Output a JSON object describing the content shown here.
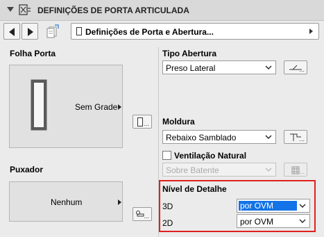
{
  "header": {
    "title": "DEFINIÇÕES DE PORTA ARTICULADA"
  },
  "toolbar": {
    "page_label": "Definições de Porta e Abertura..."
  },
  "left": {
    "folha_title": "Folha Porta",
    "folha_value": "Sem Grade",
    "puxador_title": "Puxador",
    "puxador_value": "Nenhum"
  },
  "right": {
    "tipo_abertura_title": "Tipo Abertura",
    "tipo_abertura_value": "Preso Lateral",
    "moldura_title": "Moldura",
    "moldura_value": "Rebaixo Samblado",
    "ventilacao_label": "Ventilação Natural",
    "ventilacao_checked": false,
    "ventilacao_value": "Sobre Batente",
    "detail_title": "Nível de Detalhe",
    "detail_3d_label": "3D",
    "detail_3d_value": "por OVM",
    "detail_2d_label": "2D",
    "detail_2d_value": "por OVM"
  },
  "common": {
    "ellipsis": "..."
  },
  "colors": {
    "highlight_border": "#e0201e",
    "selection": "#1473e6"
  }
}
